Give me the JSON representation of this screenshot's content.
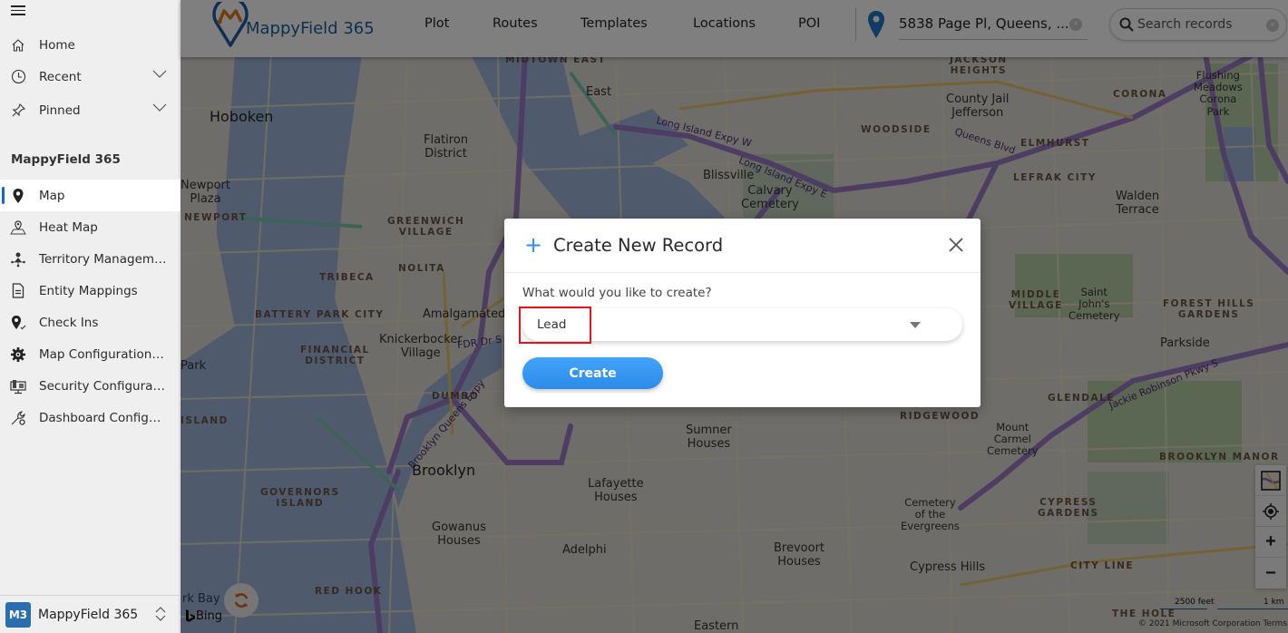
{
  "sidebar": {
    "menu_icon": "hamburger-icon",
    "top_items": [
      {
        "label": "Home",
        "icon": "home-icon"
      },
      {
        "label": "Recent",
        "icon": "clock-icon",
        "expandable": true
      },
      {
        "label": "Pinned",
        "icon": "pin-icon",
        "expandable": true
      }
    ],
    "section_title": "MappyField 365",
    "items": [
      {
        "label": "Map",
        "icon": "map-pin-icon",
        "active": true
      },
      {
        "label": "Heat Map",
        "icon": "heat-map-icon"
      },
      {
        "label": "Territory Management",
        "icon": "territory-icon"
      },
      {
        "label": "Entity Mappings",
        "icon": "document-icon"
      },
      {
        "label": "Check Ins",
        "icon": "check-in-icon"
      },
      {
        "label": "Map Configuration D...",
        "icon": "gear-icon"
      },
      {
        "label": "Security Configuratio...",
        "icon": "security-config-icon"
      },
      {
        "label": "Dashboard Configur...",
        "icon": "wrench-gear-icon"
      }
    ],
    "footer": {
      "badge": "M3",
      "app_name": "MappyField 365"
    }
  },
  "header": {
    "brand": "MappyField 365",
    "nav": [
      "Plot",
      "Routes",
      "Templates",
      "Locations",
      "POI"
    ],
    "location_value": "5838 Page Pl, Queens, ...",
    "search_placeholder": "Search records"
  },
  "map": {
    "labels": {
      "hoboken": "Hoboken",
      "newport_plaza": "Newport\nPlaza",
      "newport": "NEWPORT",
      "flatiron": "Flatiron\nDistrict",
      "greenwich": "GREENWICH\nVILLAGE",
      "nolita": "NOLITA",
      "tribeca": "TRIBECA",
      "battery": "BATTERY PARK CITY",
      "financial": "FINANCIAL\nDISTRICT",
      "amalgamated": "Amalgamated D",
      "knickerbocker": "Knickerbocker\nVillage",
      "dumbo": "DUMBO",
      "governors": "GOVERNORS\nISLAND",
      "brooklyn": "Brooklyn",
      "gowanus_houses": "Gowanus\nHouses",
      "lafayette": "Lafayette\nHouses",
      "adelphi": "Adelphi",
      "sumner": "Sumner\nHouses",
      "brevoort": "Brevoort\nHouses",
      "red_hook": "RED HOOK",
      "eastern": "Eastern",
      "blissville": "Blissville",
      "calvary": "Calvary\nCemetery",
      "east": "East",
      "woodside": "WOODSIDE",
      "jackson": "JACKSON\nHEIGHTS",
      "county_jail": "County Jail\nJefferson",
      "corona": "CORONA",
      "flushing": "Flushing\nMeadows\nCorona\nPark",
      "elmhurst": "ELMHURST",
      "lefrak": "LEFRAK CITY",
      "walden": "Walden\nTerrace",
      "middle_village": "MIDDLE\nVILLAGE",
      "saint_johns": "Saint\nJohn's\nCemetery",
      "forest_hills": "FOREST HILLS\nGARDENS",
      "parkside": "Parkside",
      "glendale": "GLENDALE",
      "ridgewood": "RIDGEWOOD",
      "mount_carmel": "Mount\nCarmel\nCemetery",
      "brooklyn_manor": "BROOKLYN MANOR",
      "cypress_gardens": "CYPRESS\nGARDENS",
      "cemetery_evergreens": "Cemetery\nof the\nEvergreens",
      "cypress_hills": "Cypress Hills",
      "city_line": "CITY LINE",
      "the_hole": "THE HOLE",
      "midtown_east": "MIDTOWN EAST",
      "park": "Park",
      "island": "ISLAND",
      "kbay": "rk Bay",
      "lie_w": "Long Island Expy W",
      "lie_e": "Long Island Expy E",
      "bqe": "Brooklyn Queens Expy",
      "jackie": "Jackie Robinson Pkwy S",
      "queens_blvd": "Queens Blvd",
      "fdr": "FDR Dr S"
    },
    "scale_feet": "2500 feet",
    "scale_km": "1 km",
    "copyright": "© 2021 Microsoft Corporation  Terms",
    "bing": "Bing",
    "controls": [
      "map-style-icon",
      "locate-icon",
      "zoom-in-icon",
      "zoom-out-icon"
    ]
  },
  "dialog": {
    "title": "Create New Record",
    "question": "What would you like to create?",
    "selected": "Lead",
    "create_label": "Create"
  },
  "colors": {
    "accent": "#2b8ff0",
    "brand_blue": "#1e5fa0",
    "brand_orange": "#e07a1f",
    "highlight": "#e0141e",
    "sidebar_active": "#0f6cbd"
  }
}
